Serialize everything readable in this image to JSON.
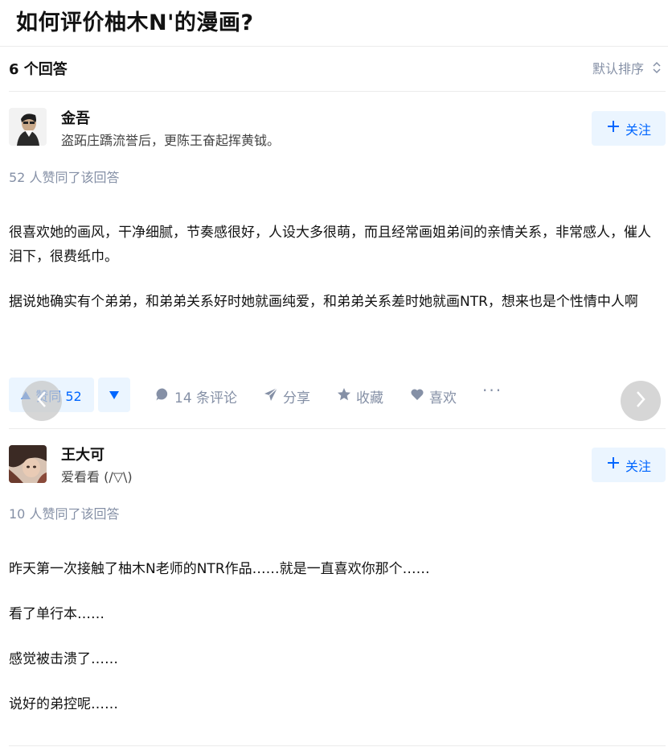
{
  "question": {
    "title": "如何评价柚木N'的漫画?"
  },
  "answers_header": {
    "count_label": "6 个回答",
    "sort_label": "默认排序"
  },
  "answers": [
    {
      "author": {
        "name": "金吾",
        "bio": "盗跖庄蹻流誉后，更陈王奋起挥黄钺。"
      },
      "follow_label": "关注",
      "vote_summary": "52 人赞同了该回答",
      "paragraphs": [
        "很喜欢她的画风，干净细腻，节奏感很好，人设大多很萌，而且经常画姐弟间的亲情关系，非常感人，催人泪下，很费纸巾。",
        "据说她确实有个弟弟，和弟弟关系好时她就画纯爱，和弟弟关系差时她就画NTR，想来也是个性情中人啊"
      ],
      "actions": {
        "upvote_label": "赞同 52",
        "comments_label": "14 条评论",
        "share_label": "分享",
        "collect_label": "收藏",
        "like_label": "喜欢",
        "more_label": "···"
      }
    },
    {
      "author": {
        "name": "王大可",
        "bio": "爱看看 (/▽\\)"
      },
      "follow_label": "关注",
      "vote_summary": "10 人赞同了该回答",
      "paragraphs": [
        "昨天第一次接触了柚木N老师的NTR作品……就是一直喜欢你那个……",
        "看了单行本……",
        "感觉被击溃了……",
        "说好的弟控呢……"
      ]
    }
  ],
  "colors": {
    "primary": "#0066ff",
    "primary_bg": "#ebf5ff",
    "muted": "#8590a6",
    "text": "#121212"
  },
  "icons": {
    "sort": "sort-updown-icon",
    "follow": "plus-icon",
    "upvote": "triangle-up-icon",
    "downvote": "triangle-down-icon",
    "comment": "comment-bubble-icon",
    "share": "paper-plane-icon",
    "collect": "star-icon",
    "like": "heart-icon",
    "carousel_prev": "chevron-left-icon",
    "carousel_next": "chevron-right-icon"
  }
}
